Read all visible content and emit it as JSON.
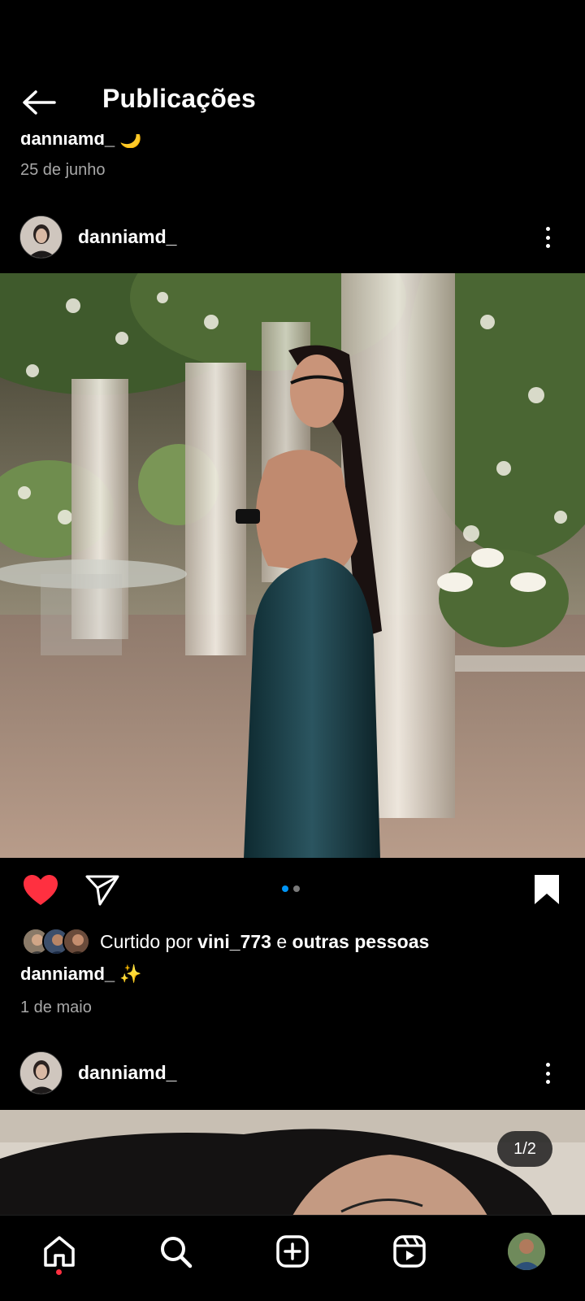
{
  "header": {
    "title": "Publicações"
  },
  "previous_post": {
    "caption": "danniamd_ 🌙",
    "date": "25 de junho"
  },
  "posts": [
    {
      "username": "danniamd_",
      "liked_by_prefix": "Curtido por",
      "liked_by_user": "vini_773",
      "liked_by_join": "e",
      "liked_by_suffix": "outras pessoas",
      "caption_user": "danniamd_",
      "caption_text": "✨",
      "date": "1 de maio",
      "carousel_total": 2,
      "carousel_active": 1,
      "liked": true,
      "saved": true
    },
    {
      "username": "danniamd_",
      "counter": "1/2"
    }
  ],
  "icons": {
    "back": "arrow-left-icon",
    "more": "more-vertical-icon",
    "like": "heart-filled-icon",
    "share": "send-icon",
    "save": "bookmark-filled-icon",
    "nav": [
      "home-icon",
      "search-icon",
      "add-icon",
      "reels-icon",
      "profile-avatar"
    ]
  },
  "colors": {
    "like": "#ff3040",
    "carousel_active": "#0095f6",
    "background": "#000000"
  }
}
